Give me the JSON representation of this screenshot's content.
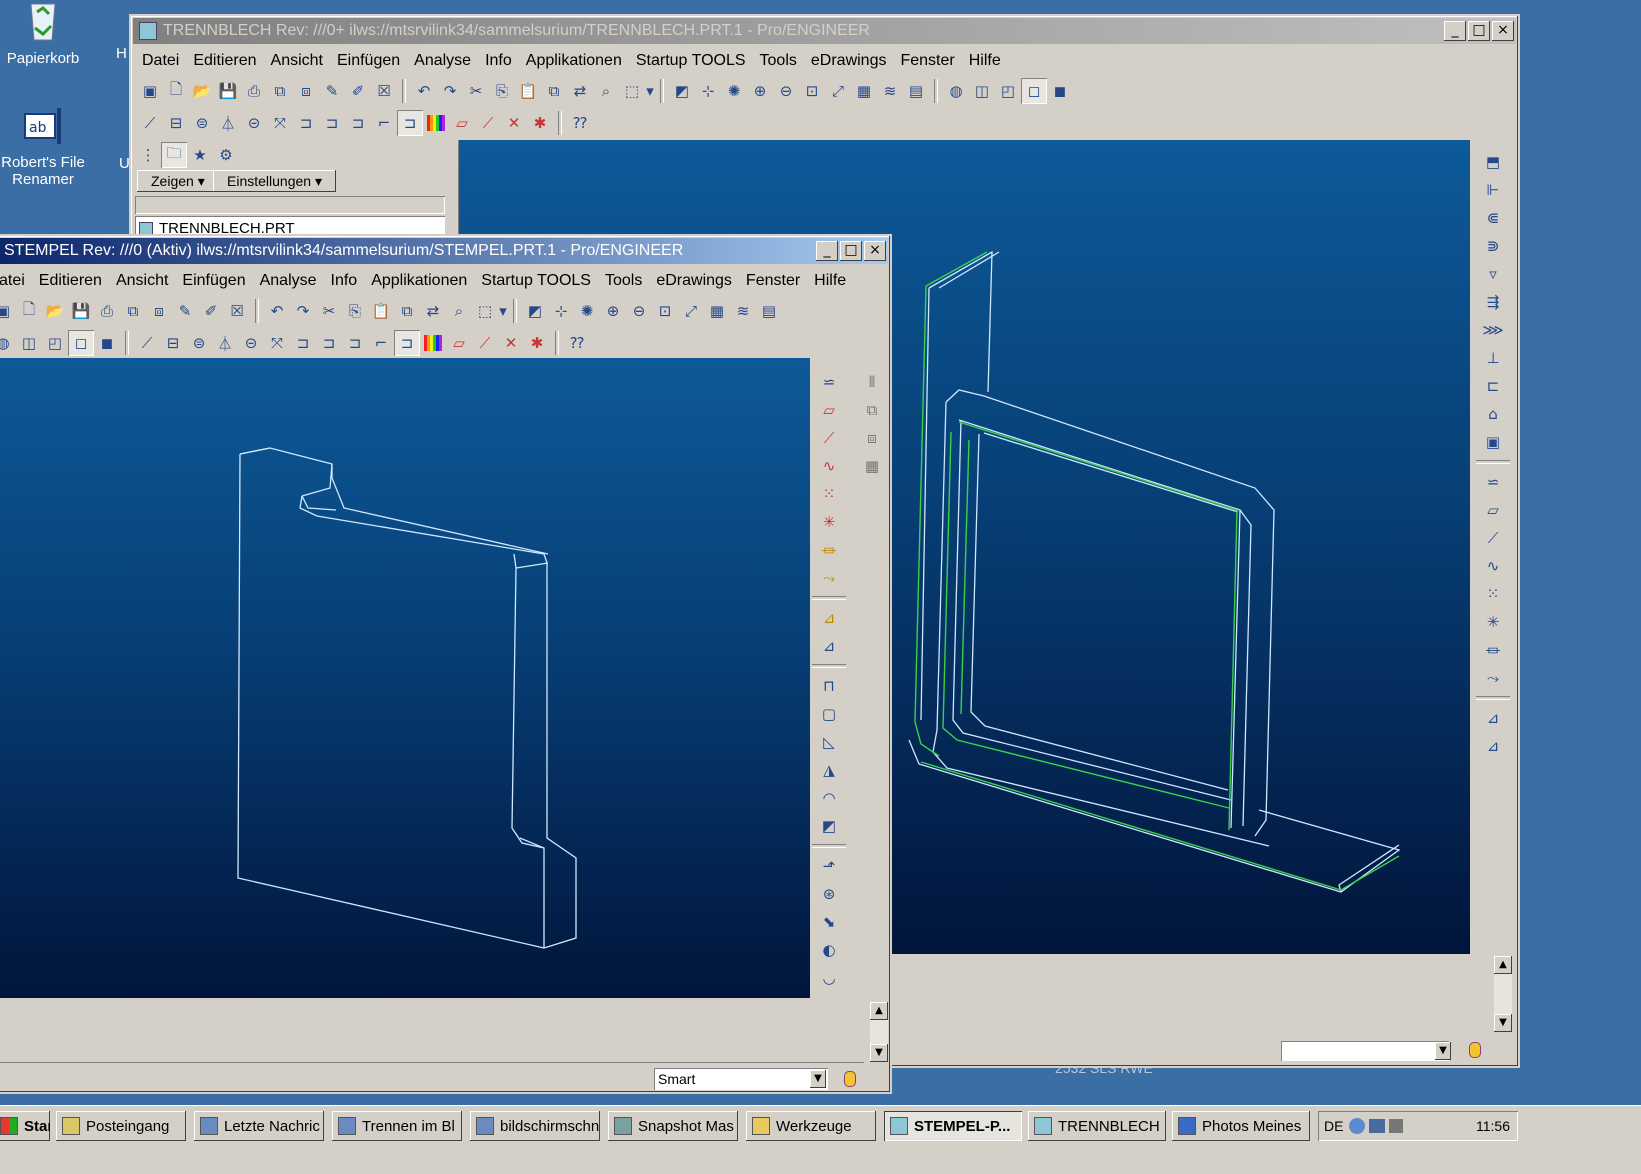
{
  "desktop": {
    "icons": [
      {
        "label": "Papierkorb"
      },
      {
        "label": "Robert's File Renamer"
      }
    ],
    "partial_letters": [
      "H",
      "U"
    ],
    "bottom_text": "2532 SLS RWE"
  },
  "window_back": {
    "title": "TRENNBLECH Rev: ///0+ ilws://mtsrvilink34/sammelsurium/TRENNBLECH.PRT.1 - Pro/ENGINEER",
    "menu": [
      "Datei",
      "Editieren",
      "Ansicht",
      "Einfügen",
      "Analyse",
      "Info",
      "Applikationen",
      "Startup TOOLS",
      "Tools",
      "eDrawings",
      "Fenster",
      "Hilfe"
    ],
    "navigator": {
      "zeigen": "Zeigen",
      "einstellungen": "Einstellungen",
      "tree_item": "TRENNBLECH.PRT"
    },
    "filter_value": ""
  },
  "window_front": {
    "title": "STEMPEL Rev: ///0 (Aktiv) ilws://mtsrvilink34/sammelsurium/STEMPEL.PRT.1 - Pro/ENGINEER",
    "menu": [
      "atei",
      "Editieren",
      "Ansicht",
      "Einfügen",
      "Analyse",
      "Info",
      "Applikationen",
      "Startup TOOLS",
      "Tools",
      "eDrawings",
      "Fenster",
      "Hilfe"
    ],
    "filter_value": "Smart"
  },
  "window_buttons": {
    "min": "_",
    "max": "□",
    "close": "×"
  },
  "taskbar": {
    "start": "Start",
    "tasks": [
      "Posteingang",
      "Letzte Nachric",
      "Trennen im Bl",
      "bildschirmschn",
      "Snapshot Mas",
      "Werkzeuge",
      "STEMPEL-P...",
      "TRENNBLECH",
      "Photos Meines"
    ],
    "tray_lang": "DE",
    "clock": "11:56"
  },
  "colors": {
    "desktop": "#3a6ea5",
    "wireframe_cyan": "#cfe8ff",
    "wireframe_green": "#38d24a",
    "viewport_top": "#0d5a98",
    "viewport_bottom": "#01153b"
  }
}
